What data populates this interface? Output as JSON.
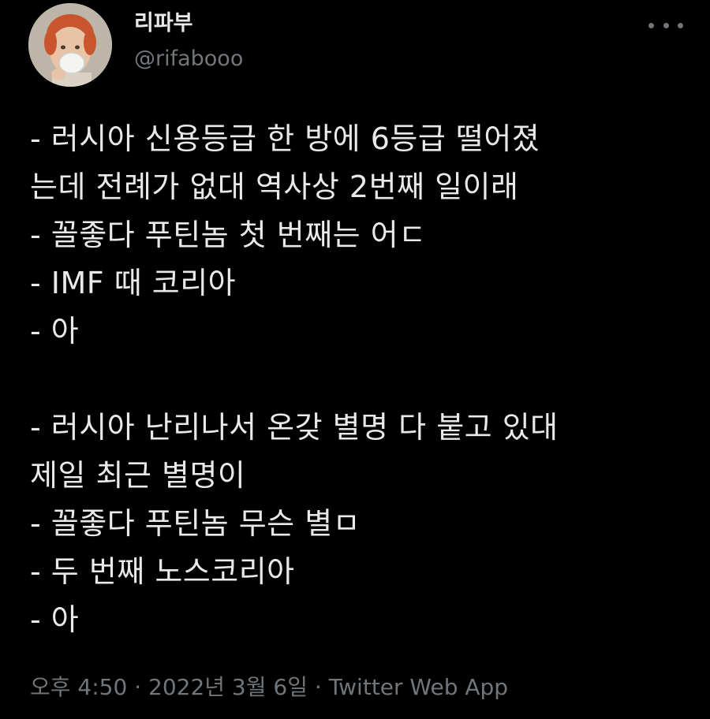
{
  "author": {
    "display_name": "리파부",
    "handle": "@rifabooo",
    "avatar_icon": "profile-avatar"
  },
  "more_icon": "more-horizontal-icon",
  "tweet": {
    "lines": [
      "- 러시아 신용등급 한 방에 6등급 떨어졌",
      "는데 전례가 없대 역사상 2번째 일이래",
      "- 꼴좋다 푸틴놈 첫 번째는 어ㄷ",
      "- IMF 때 코리아",
      "- 아",
      "",
      "- 러시아 난리나서 온갖 별명 다 붙고 있대",
      "제일 최근 별명이",
      "- 꼴좋다 푸틴놈 무슨 별ㅁ",
      "- 두 번째 노스코리아",
      "- 아"
    ]
  },
  "meta": {
    "time": "오후 4:50",
    "separator": " · ",
    "date": "2022년 3월 6일",
    "source": "Twitter Web App"
  },
  "colors": {
    "background": "#000000",
    "primary_text": "#e7e9ea",
    "secondary_text": "#71767b"
  }
}
